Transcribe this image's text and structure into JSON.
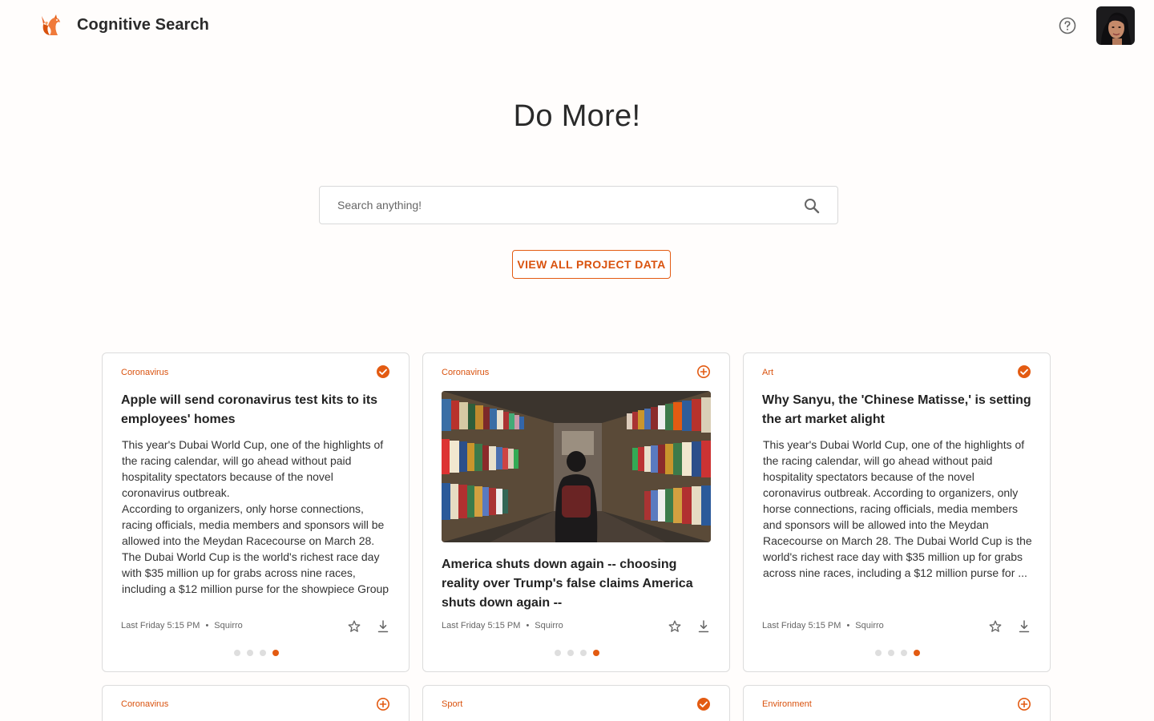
{
  "app": {
    "title": "Cognitive Search"
  },
  "hero": {
    "heading": "Do More!"
  },
  "search": {
    "placeholder": "Search anything!",
    "value": ""
  },
  "actions": {
    "view_all_label": "VIEW ALL PROJECT DATA"
  },
  "colors": {
    "accent": "#e35b12",
    "border": "#dcdcdc",
    "background": "#fffdfc"
  },
  "cards": [
    {
      "category": "Coronavirus",
      "saved": true,
      "title": "Apple will send coronavirus test kits to its employees' homes",
      "body": "This year's Dubai World Cup, one of the highlights of the racing calendar, will go ahead without paid hospitality spectators because of the novel coronavirus outbreak.\nAccording to organizers, only horse connections, racing officials, media members and sponsors will be allowed into the Meydan Racecourse on March 28.\nThe Dubai World Cup is the world's richest race day with $35 million up for grabs across nine races, including a $12 million purse for the showpiece Group",
      "timestamp": "Last Friday 5:15 PM",
      "source": "Squirro",
      "active_page": 4
    },
    {
      "category": "Coronavirus",
      "saved": false,
      "title": "America shuts down again -- choosing reality over Trump's false claims America shuts down again --",
      "image": "library-bookshelves-photo",
      "timestamp": "Last Friday 5:15 PM",
      "source": "Squirro",
      "active_page": 4
    },
    {
      "category": "Art",
      "saved": true,
      "title": "Why Sanyu, the 'Chinese Matisse,' is setting the art market alight",
      "body": "This year's Dubai World Cup, one of the highlights of the racing calendar, will go ahead without paid hospitality spectators because of the novel coronavirus outbreak. According to organizers, only horse connections, racing officials, media members and sponsors will be allowed into the Meydan Racecourse on March 28. The Dubai World Cup is the world's richest race day with $35 million up for grabs across nine races, including a $12 million purse for ...",
      "timestamp": "Last Friday 5:15 PM",
      "source": "Squirro",
      "active_page": 4
    },
    {
      "category": "Coronavirus",
      "saved": false
    },
    {
      "category": "Sport",
      "saved": true
    },
    {
      "category": "Environment",
      "saved": false
    }
  ],
  "meta_separator": "•"
}
